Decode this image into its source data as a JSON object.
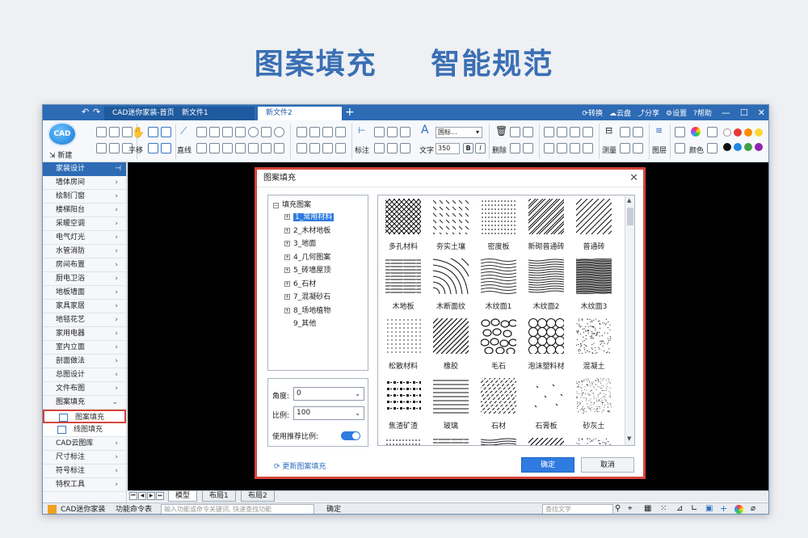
{
  "headline": {
    "left": "图案填充",
    "right": "智能规范"
  },
  "titlebar": {
    "tabs": [
      "CAD迷你家装-首页",
      "新文件1",
      "新文件2"
    ],
    "actions": [
      "转换",
      "云盘",
      "分享",
      "设置",
      "帮助"
    ]
  },
  "ribbon": {
    "new": "新建",
    "pan": "平移",
    "line": "直线",
    "mark": "标注",
    "text": "文字",
    "font_value": "国标...",
    "size_value": "350",
    "delete": "删除",
    "measure": "测量",
    "layer": "图层",
    "color": "颜色"
  },
  "sidebar": {
    "header": "家装设计",
    "items": [
      "墙体房间",
      "绘制门窗",
      "楼梯阳台",
      "采暖空调",
      "电气灯光",
      "水管消防",
      "房间布置",
      "厨电卫浴",
      "地板墙面",
      "家具家居",
      "地毯花艺",
      "家用电器",
      "室内立面",
      "剖面做法",
      "总图设计",
      "文件布图",
      "图案填充"
    ],
    "sub_items": [
      "图案填充",
      "线图填充"
    ],
    "after_items": [
      "CAD云图库",
      "尺寸标注",
      "符号标注",
      "特权工具"
    ]
  },
  "bottom_tabs": [
    "模型",
    "布局1",
    "布局2"
  ],
  "status": {
    "app": "CAD迷你家装",
    "command_label": "功能命令表",
    "command_placeholder": "输入功能或命令关键词, 快速查找功能",
    "confirm": "确定",
    "search_placeholder": "查找文字"
  },
  "dialog": {
    "title": "图案填充",
    "tree_root": "填充图案",
    "tree_items": [
      "1_常用材料",
      "2_木材地板",
      "3_地面",
      "4_几何图案",
      "5_砖墙屋顶",
      "6_石材",
      "7_混凝砂石",
      "8_场地植物",
      "9_其他"
    ],
    "angle_label": "角度:",
    "angle_value": "0",
    "scale_label": "比例:",
    "scale_value": "100",
    "recommend_label": "使用推荐比例:",
    "refresh": "更新图案填充",
    "ok": "确定",
    "cancel": "取消",
    "patterns": [
      "多孔材料",
      "夯实土壤",
      "密度板",
      "新砌普通砖",
      "普通砖",
      "木地板",
      "木断面纹",
      "木纹面1",
      "木纹面2",
      "木纹面3",
      "松散材料",
      "橡胶",
      "毛石",
      "泡沫塑料材",
      "混凝土",
      "焦渣矿渣",
      "玻璃",
      "石材",
      "石膏板",
      "砂灰土"
    ]
  },
  "colors": {
    "brand": "#2d6bb5",
    "accent": "#2f7be0",
    "highlight": "#d6453b"
  }
}
